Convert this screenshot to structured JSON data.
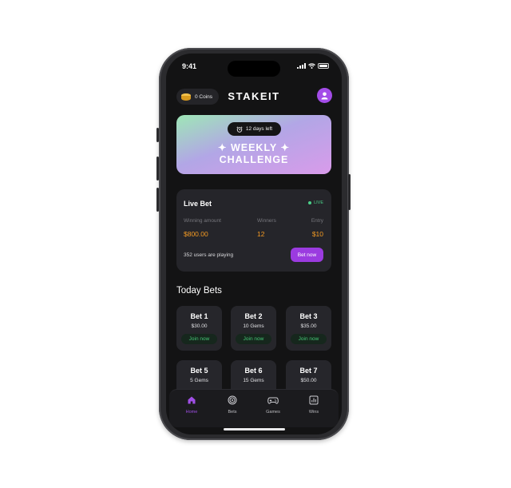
{
  "status": {
    "time": "9:41"
  },
  "header": {
    "coins_label": "0 Coins",
    "brand": "STAKEIT"
  },
  "challenge": {
    "days_left": "12 days left",
    "title_line1": "✦ WEEKLY ✦",
    "title_line2": "CHALLENGE",
    "gradient": [
      "#9ee7b6",
      "#b2a6e6",
      "#d99bea"
    ]
  },
  "live_bet": {
    "title": "Live Bet",
    "badge": "LIVE",
    "labels": {
      "winning": "Winning amount",
      "winners": "Winners",
      "entry": "Entry"
    },
    "values": {
      "winning": "$800.00",
      "winners": "12",
      "entry": "$10"
    },
    "players": "352 users are playing",
    "button": "Bet now"
  },
  "today": {
    "title": "Today Bets",
    "bets": [
      {
        "name": "Bet 1",
        "amount": "$30.00",
        "join": "Join now"
      },
      {
        "name": "Bet 2",
        "amount": "10 Gems",
        "join": "Join now"
      },
      {
        "name": "Bet 3",
        "amount": "$35.00",
        "join": "Join now"
      },
      {
        "name": "Bet 5",
        "amount": "5 Gems"
      },
      {
        "name": "Bet 6",
        "amount": "15 Gems"
      },
      {
        "name": "Bet 7",
        "amount": "$50.00"
      }
    ]
  },
  "tabbar": {
    "tabs": [
      {
        "label": "Home",
        "icon": "home-icon",
        "active": true
      },
      {
        "label": "Bets",
        "icon": "target-icon"
      },
      {
        "label": "Games",
        "icon": "gamepad-icon"
      },
      {
        "label": "Wins",
        "icon": "chart-icon"
      }
    ]
  },
  "colors": {
    "accent": "#9b3be0",
    "live": "#4bd089",
    "amount": "#f39a23",
    "join": "#45c776"
  }
}
